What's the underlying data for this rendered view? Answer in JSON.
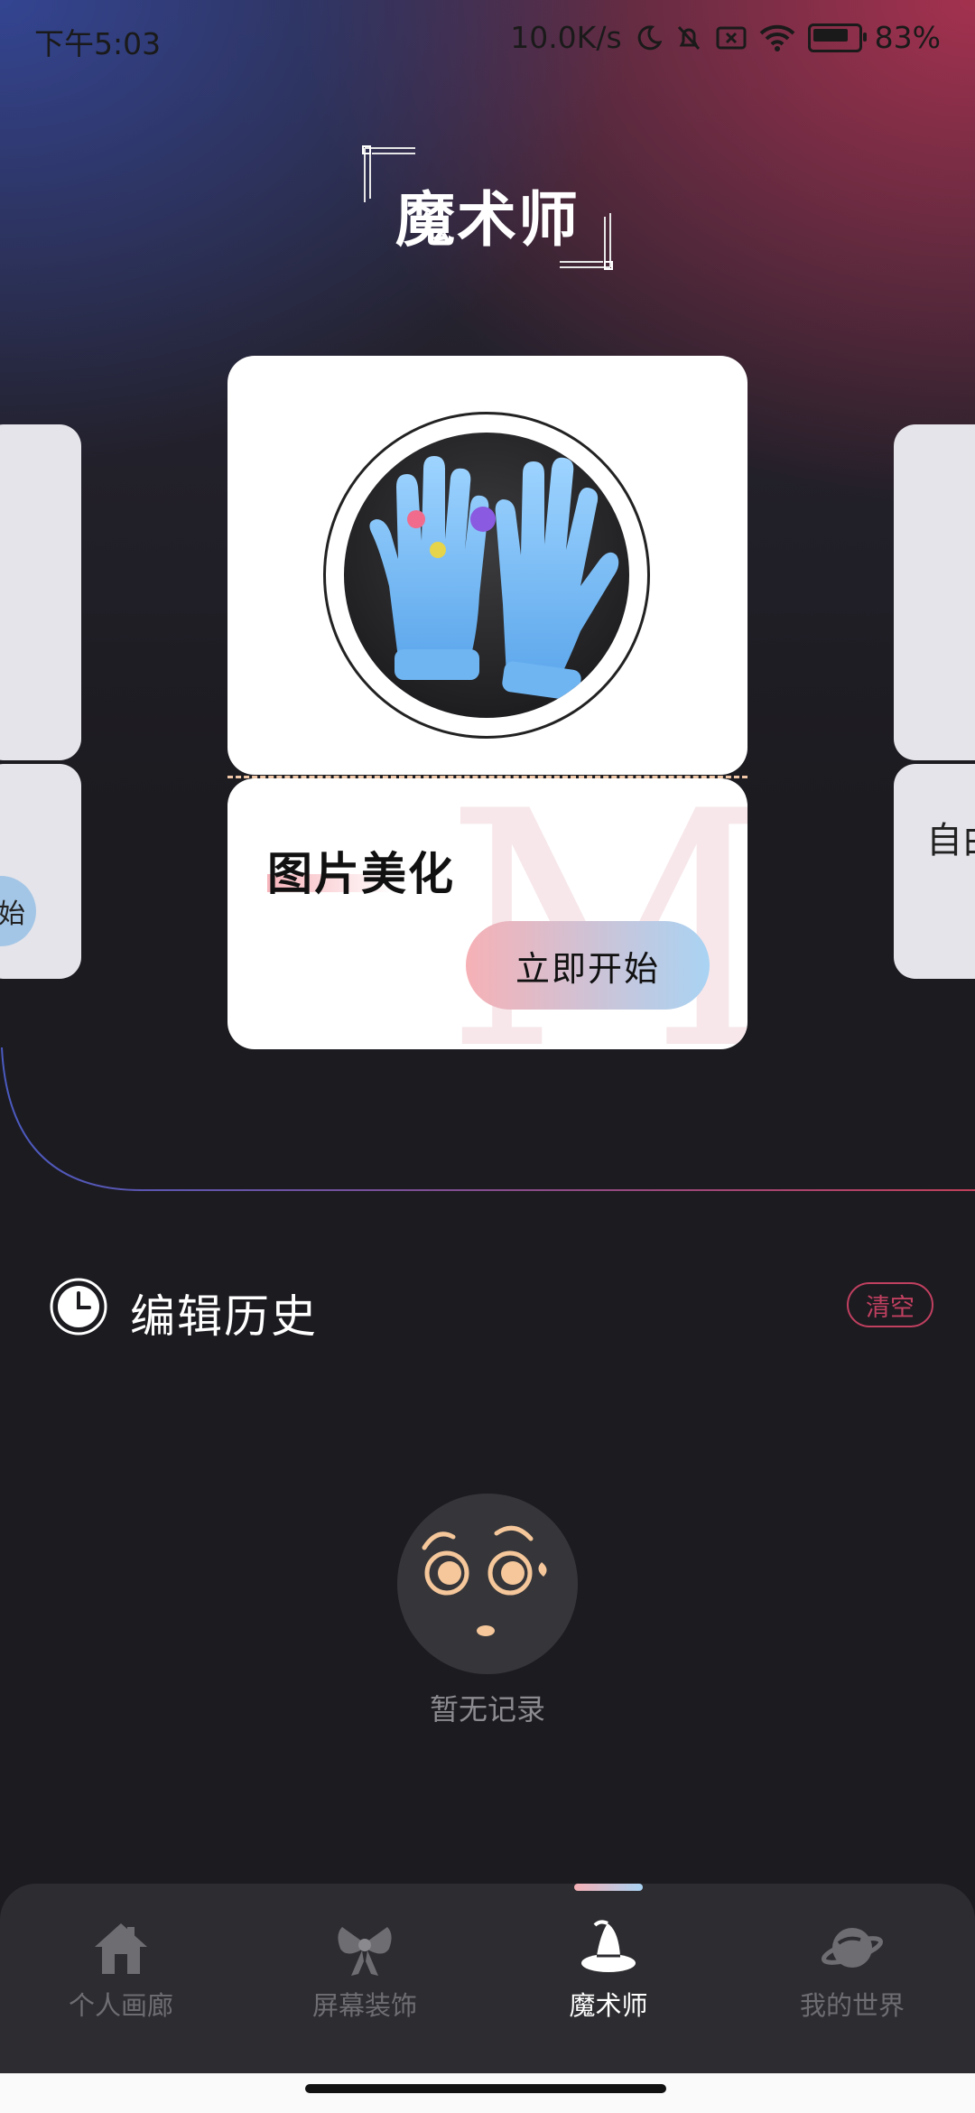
{
  "status_bar": {
    "time": "下午5:03",
    "network_speed": "10.0K/s",
    "battery": "83%"
  },
  "header": {
    "title": "魔术师"
  },
  "carousel": {
    "current": {
      "name": "图片美化",
      "action_label": "立即开始",
      "watermark": "M",
      "image": "blue-gloves-image"
    },
    "left_peek": {
      "action_label": "始"
    },
    "right_peek": {
      "name": "自由"
    }
  },
  "history": {
    "title": "编辑历史",
    "clear_label": "清空",
    "empty_text": "暂无记录"
  },
  "bottom_nav": {
    "items": [
      {
        "label": "个人画廊",
        "icon": "house-icon",
        "active": false
      },
      {
        "label": "屏幕装饰",
        "icon": "bow-icon",
        "active": false
      },
      {
        "label": "魔术师",
        "icon": "wizard-hat-icon",
        "active": true
      },
      {
        "label": "我的世界",
        "icon": "planet-icon",
        "active": false
      }
    ]
  },
  "colors": {
    "accent_pink": "#f6b1b6",
    "accent_blue": "#a9d3f3",
    "clear_red": "#c04060",
    "background": "#1c1b20"
  }
}
